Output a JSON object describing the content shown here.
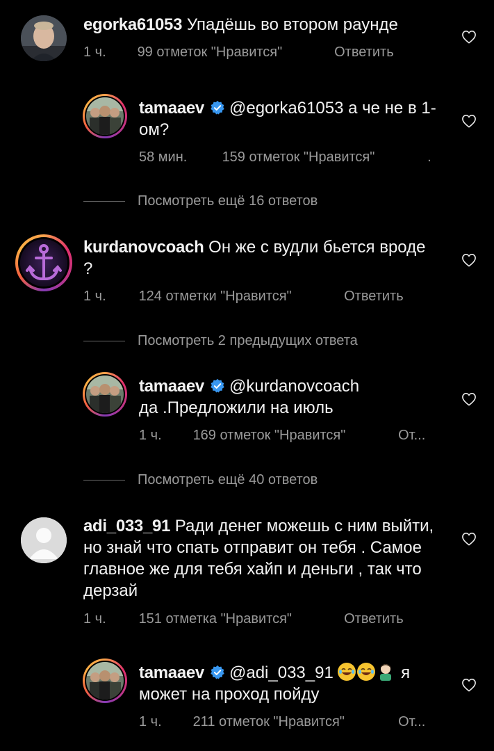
{
  "comments": [
    {
      "username": "egorka61053",
      "text": "Упадёшь во втором раунде",
      "time": "1 ч.",
      "likes": "99 отметок \"Нравится\"",
      "reply": "Ответить"
    },
    {
      "username": "tamaaev",
      "verified": true,
      "mention": "@egorka61053",
      "text": "а че не в 1-ом?",
      "time": "58 мин.",
      "likes": "159 отметок \"Нравится\"",
      "reply": "."
    },
    {
      "username": "kurdanovcoach",
      "text": "Он же с вудли бьется вроде ?",
      "time": "1 ч.",
      "likes": "124 отметки \"Нравится\"",
      "reply": "Ответить"
    },
    {
      "username": "tamaaev",
      "verified": true,
      "mention": "@kurdanovcoach",
      "text": "да .Предложили на июль",
      "time": "1 ч.",
      "likes": "169 отметок \"Нравится\"",
      "reply": "От..."
    },
    {
      "username": "adi_033_91",
      "text": "Ради денег можешь с ним выйти, но знай что спать отправит он тебя . Самое главное же для тебя хайп и деньги , так что дерзай",
      "time": "1 ч.",
      "likes": "151 отметка \"Нравится\"",
      "reply": "Ответить"
    },
    {
      "username": "tamaaev",
      "verified": true,
      "mention": "@adi_033_91",
      "text": "я может на проход пойду",
      "time": "1 ч.",
      "likes": "211 отметок \"Нравится\"",
      "reply": "От..."
    }
  ],
  "view_more": [
    "Посмотреть ещё 16 ответов",
    "Посмотреть 2 предыдущих ответа",
    "Посмотреть ещё 40 ответов"
  ],
  "colors": {
    "background": "#000000",
    "text": "#f5f5f5",
    "secondary": "#9a9a9a",
    "verified": "#3897f0"
  },
  "icons": [
    "heart-icon",
    "verified-badge-icon",
    "anchor-icon",
    "laughing-emoji-icon",
    "facepalm-emoji-icon"
  ]
}
